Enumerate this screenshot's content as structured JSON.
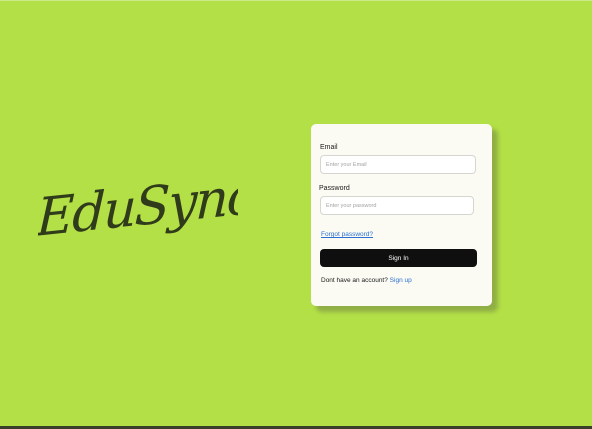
{
  "brand": {
    "logo_text": "EduSync"
  },
  "login_form": {
    "email_label": "Email",
    "email_placeholder": "Enter your Email",
    "email_value": "",
    "password_label": "Password",
    "password_placeholder": "Enter your password",
    "password_value": "",
    "forgot_password_label": "Forgot password?",
    "sign_in_label": "Sign In",
    "no_account_text": "Dont have an account?",
    "sign_up_label": "Sign up"
  },
  "colors": {
    "background": "#b3e046",
    "card": "#fbfbf3",
    "button": "#0f0f0f",
    "link": "#2a6fd1",
    "logo": "#2f3b1a"
  }
}
